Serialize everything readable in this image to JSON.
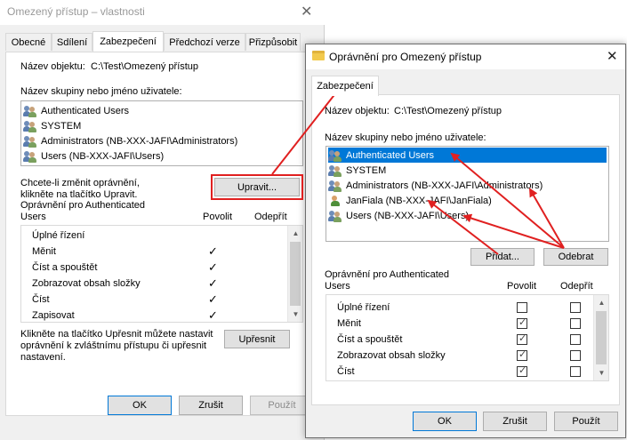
{
  "back_window": {
    "title": "Omezený přístup – vlastnosti",
    "tabs": [
      "Obecné",
      "Sdílení",
      "Zabezpečení",
      "Předchozí verze",
      "Přizpůsobit"
    ],
    "object_name_label": "Název objektu:",
    "object_name_value": "C:\\Test\\Omezený přístup",
    "groups_label": "Název skupiny nebo jméno uživatele:",
    "groups": [
      "Authenticated Users",
      "SYSTEM",
      "Administrators (NB-XXX-JAFI\\Administrators)",
      "Users (NB-XXX-JAFI\\Users)"
    ],
    "change_hint_line1": "Chcete-li změnit oprávnění,",
    "change_hint_line2": "klikněte na tlačítko Upravit.",
    "edit_button": "Upravit...",
    "perm_for_label_line1": "Oprávnění pro Authenticated",
    "perm_for_label_line2": "Users",
    "allow_header": "Povolit",
    "deny_header": "Odepřít",
    "permissions": [
      "Úplné řízení",
      "Měnit",
      "Číst a spouštět",
      "Zobrazovat obsah složky",
      "Číst",
      "Zapisovat"
    ],
    "advanced_hint_line1": "Klikněte na tlačítko Upřesnit můžete nastavit",
    "advanced_hint_line2": "oprávnění k zvláštnímu přístupu či upřesnit",
    "advanced_hint_line3": "nastavení.",
    "advanced_button": "Upřesnit",
    "ok_button": "OK",
    "cancel_button": "Zrušit",
    "apply_button": "Použít"
  },
  "front_window": {
    "title": "Oprávnění pro Omezený přístup",
    "tab": "Zabezpečení",
    "object_name_label": "Název objektu:",
    "object_name_value": "C:\\Test\\Omezený přístup",
    "groups_label": "Název skupiny nebo jméno uživatele:",
    "groups": [
      "Authenticated Users",
      "SYSTEM",
      "Administrators (NB-XXX-JAFI\\Administrators)",
      "JanFiala (NB-XXX-JAFI\\JanFiala)",
      "Users (NB-XXX-JAFI\\Users)"
    ],
    "add_button": "Přidat...",
    "remove_button": "Odebrat",
    "perm_for_label_line1": "Oprávnění pro Authenticated",
    "perm_for_label_line2": "Users",
    "allow_header": "Povolit",
    "deny_header": "Odepřít",
    "permissions": [
      "Úplné řízení",
      "Měnit",
      "Číst a spouštět",
      "Zobrazovat obsah složky",
      "Číst"
    ],
    "ok_button": "OK",
    "cancel_button": "Zrušit",
    "apply_button": "Použít"
  },
  "colors": {
    "selection": "#0078d7",
    "annotation": "#e02020"
  }
}
